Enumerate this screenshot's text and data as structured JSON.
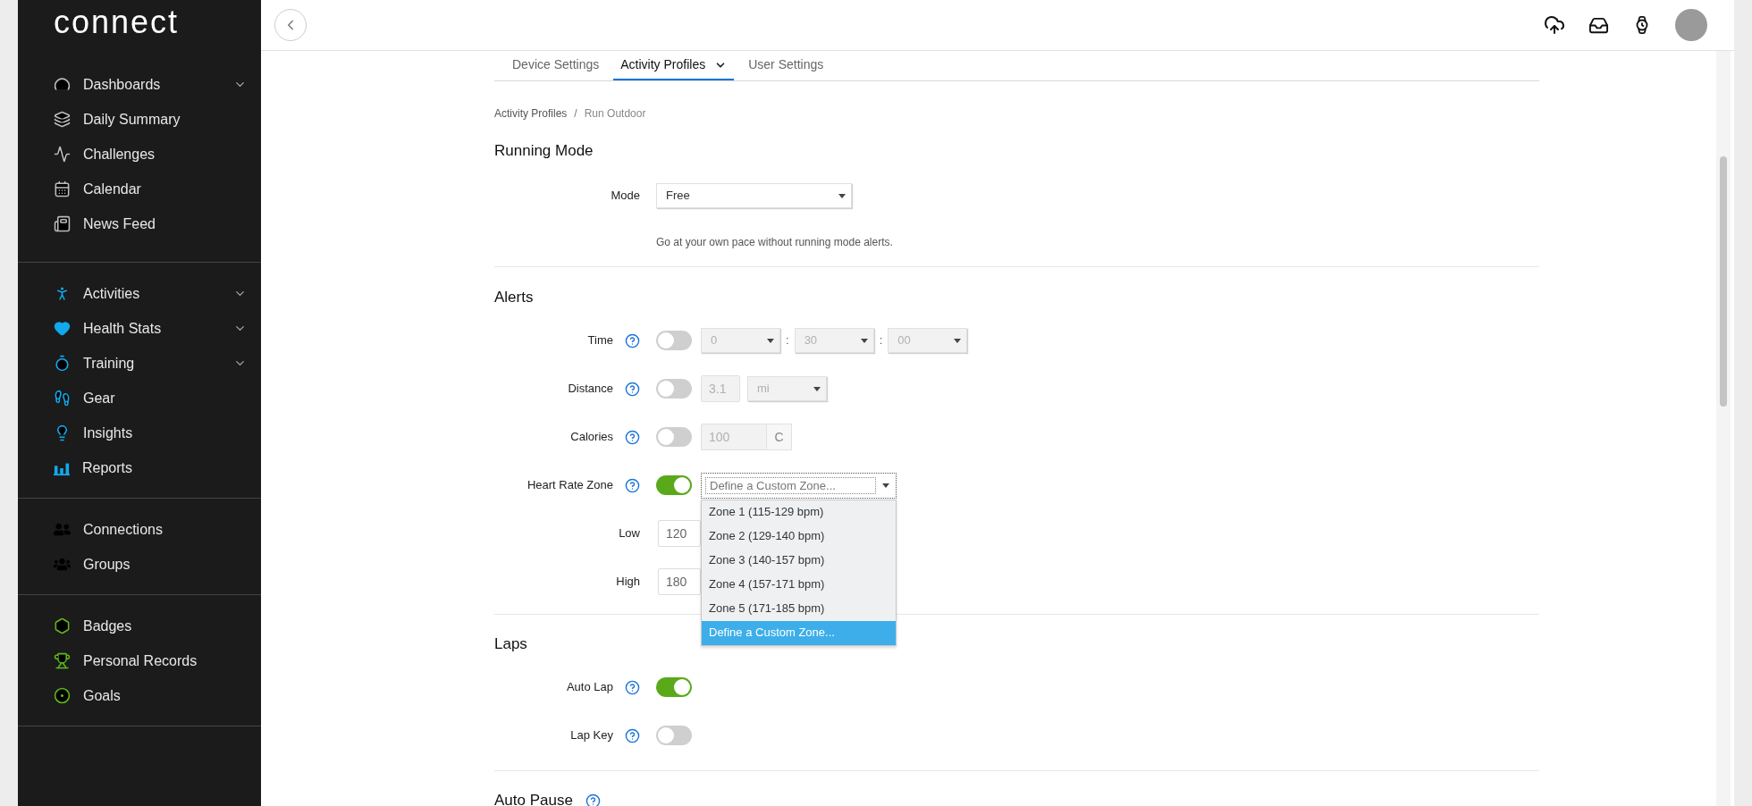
{
  "sidebar": {
    "logo": "connect",
    "groups": [
      {
        "items": [
          {
            "label": "Dashboards",
            "has_submenu": true
          },
          {
            "label": "Daily Summary",
            "has_submenu": false
          },
          {
            "label": "Challenges",
            "has_submenu": false
          },
          {
            "label": "Calendar",
            "has_submenu": false
          },
          {
            "label": "News Feed",
            "has_submenu": false
          }
        ]
      },
      {
        "items": [
          {
            "label": "Activities",
            "has_submenu": true
          },
          {
            "label": "Health Stats",
            "has_submenu": true
          },
          {
            "label": "Training",
            "has_submenu": true
          },
          {
            "label": "Gear",
            "has_submenu": false
          },
          {
            "label": "Insights",
            "has_submenu": false
          },
          {
            "label": "Reports",
            "has_submenu": false
          }
        ]
      },
      {
        "items": [
          {
            "label": "Connections",
            "has_submenu": false
          },
          {
            "label": "Groups",
            "has_submenu": false
          }
        ]
      },
      {
        "items": [
          {
            "label": "Badges",
            "has_submenu": false
          },
          {
            "label": "Personal Records",
            "has_submenu": false
          },
          {
            "label": "Goals",
            "has_submenu": false
          }
        ]
      }
    ]
  },
  "tabs": [
    {
      "label": "Device Settings",
      "selected": false,
      "has_menu": false
    },
    {
      "label": "Activity Profiles",
      "selected": true,
      "has_menu": true
    },
    {
      "label": "User Settings",
      "selected": false,
      "has_menu": false
    }
  ],
  "breadcrumb": {
    "items": [
      "Activity Profiles",
      "Run Outdoor"
    ],
    "separator": "/"
  },
  "running_mode": {
    "title": "Running Mode",
    "mode": {
      "label": "Mode",
      "value": "Free"
    },
    "description": "Go at your own pace without running mode alerts."
  },
  "alerts": {
    "title": "Alerts",
    "rows": [
      {
        "kind": "time",
        "label": "Time",
        "on": false,
        "fields": [
          "0",
          "30",
          "00"
        ],
        "separator": ":"
      },
      {
        "kind": "distance",
        "label": "Distance",
        "on": false,
        "value": "3.1",
        "unit": "mi"
      },
      {
        "kind": "calories",
        "label": "Calories",
        "on": false,
        "value": "100",
        "unit": "C"
      },
      {
        "kind": "zone",
        "label": "Heart Rate Zone",
        "on": true,
        "value": "Define a Custom Zone...",
        "options": [
          {
            "label": "Zone 1 (115-129 bpm)",
            "selected": false
          },
          {
            "label": "Zone 2 (129-140 bpm)",
            "selected": false
          },
          {
            "label": "Zone 3 (140-157 bpm)",
            "selected": false
          },
          {
            "label": "Zone 4 (157-171 bpm)",
            "selected": false
          },
          {
            "label": "Zone 5 (171-185 bpm)",
            "selected": false
          },
          {
            "label": "Define a Custom Zone...",
            "selected": true
          }
        ]
      },
      {
        "kind": "number",
        "label": "Low",
        "value": "120"
      },
      {
        "kind": "number",
        "label": "High",
        "value": "180"
      }
    ]
  },
  "laps": {
    "title": "Laps",
    "rows": [
      {
        "label": "Auto Lap",
        "on": true
      },
      {
        "label": "Lap Key",
        "on": false
      }
    ]
  },
  "auto_pause": {
    "title": "Auto Pause"
  }
}
